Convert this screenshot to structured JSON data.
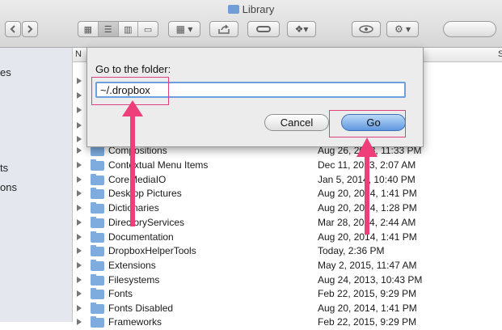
{
  "window": {
    "title": "Library"
  },
  "sidebar": {
    "items": [
      "es",
      "ts",
      "ons"
    ]
  },
  "list": {
    "header": {
      "name_col": "N",
      "size_col": "S"
    },
    "rows": [
      {
        "name": "Compositions",
        "date": "Aug 26, 2013, 11:33 PM"
      },
      {
        "name": "Contextual Menu Items",
        "date": "Dec 11, 2013, 2:07 AM"
      },
      {
        "name": "CoreMediaIO",
        "date": "Jan 5, 2014, 10:40 PM"
      },
      {
        "name": "Desktop Pictures",
        "date": "Aug 20, 2014, 1:41 PM"
      },
      {
        "name": "Dictionaries",
        "date": "Aug 20, 2014, 1:28 PM"
      },
      {
        "name": "DirectoryServices",
        "date": "Mar 28, 2014, 2:44 AM"
      },
      {
        "name": "Documentation",
        "date": "Aug 20, 2014, 1:41 PM"
      },
      {
        "name": "DropboxHelperTools",
        "date": "Today, 2:36 PM"
      },
      {
        "name": "Extensions",
        "date": "May 2, 2015, 11:47 AM"
      },
      {
        "name": "Filesystems",
        "date": "Aug 24, 2013, 10:43 PM"
      },
      {
        "name": "Fonts",
        "date": "Feb 22, 2015, 9:29 PM"
      },
      {
        "name": "Fonts Disabled",
        "date": "Aug 20, 2014, 1:41 PM"
      },
      {
        "name": "Frameworks",
        "date": "Feb 22, 2015, 9:29 PM"
      }
    ]
  },
  "dialog": {
    "label": "Go to the folder:",
    "input_value": "~/.dropbox",
    "cancel_label": "Cancel",
    "go_label": "Go"
  },
  "colors": {
    "accent": "#5f98e0",
    "annotation": "#ee3f7b"
  }
}
